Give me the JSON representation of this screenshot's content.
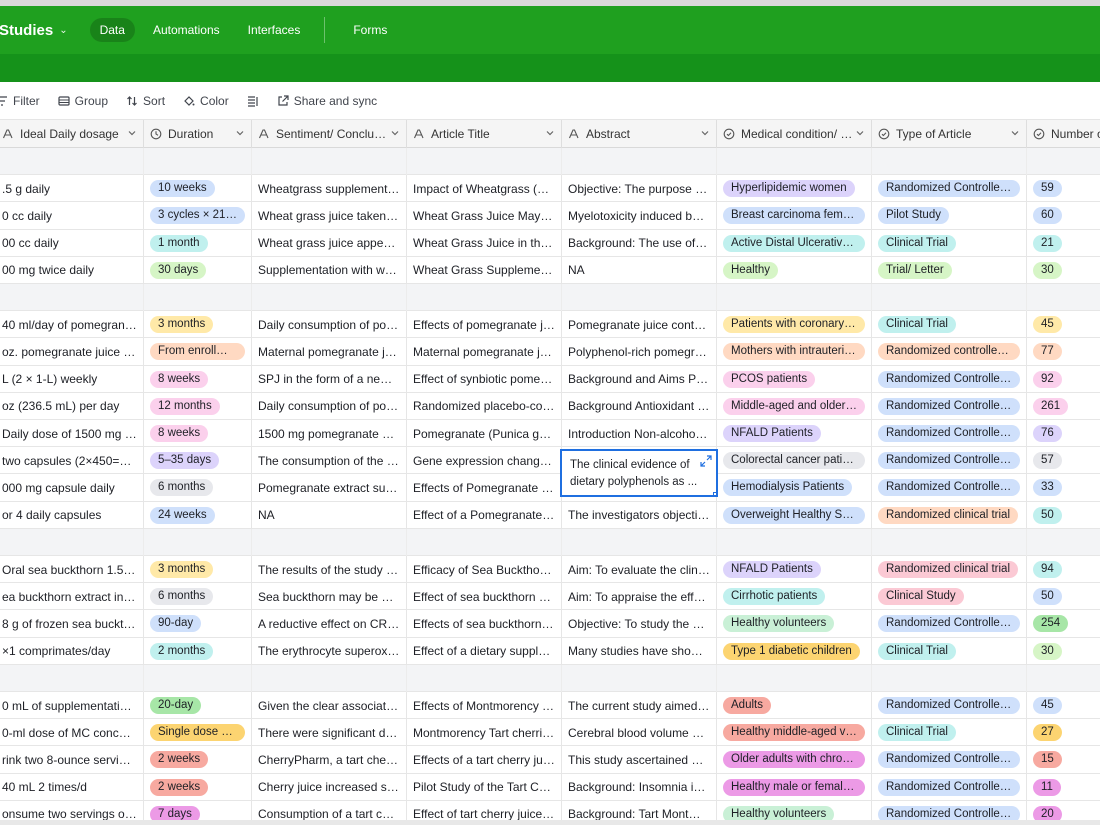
{
  "app": {
    "title": "Studies",
    "tabs": [
      {
        "label": "Data"
      },
      {
        "label": "Automations"
      },
      {
        "label": "Interfaces"
      },
      {
        "label": "Forms"
      }
    ]
  },
  "toolbar": {
    "filter": "Filter",
    "group": "Group",
    "sort": "Sort",
    "color": "Color",
    "share": "Share and sync"
  },
  "columns": [
    {
      "label": "Ideal Daily dosage"
    },
    {
      "label": "Duration"
    },
    {
      "label": "Sentiment/ Conclusion"
    },
    {
      "label": "Article Title"
    },
    {
      "label": "Abstract"
    },
    {
      "label": "Medical condition/ P..."
    },
    {
      "label": "Type of Article"
    },
    {
      "label": "Number of"
    }
  ],
  "colors": {
    "blue": "#cfe0fb",
    "green": "#c9f0d6",
    "yellow": "#ffe9a8",
    "orange": "#ffd9c2",
    "pink": "#fbd0ec",
    "purple": "#dcd3fb",
    "teal": "#c0f0ee",
    "grey": "#e7e8ec",
    "lime": "#d6f5c6",
    "darkgreen": "#a7e6a7",
    "gold": "#fcd471",
    "red": "#f7a9a0",
    "magenta": "#ec9ae6",
    "lightpink": "#fbc9d4"
  },
  "rows": [
    {
      "blank": true
    },
    {
      "dosage": ".5 g daily",
      "duration": {
        "text": "10 weeks",
        "color": "blue"
      },
      "sentiment": "Wheatgrass supplementati...",
      "title": "Impact of Wheatgrass (Triti...",
      "abstract": "Objective: The purpose of t...",
      "condition": {
        "text": "Hyperlipidemic women",
        "color": "purple"
      },
      "type": {
        "text": "Randomized Controlled ...",
        "color": "blue"
      },
      "number": {
        "text": "59",
        "color": "blue"
      }
    },
    {
      "dosage": "0 cc daily",
      "duration": {
        "text": "3 cycles × 21 d...",
        "color": "blue"
      },
      "sentiment": "Wheat grass juice taken du...",
      "title": "Wheat Grass Juice May Im...",
      "abstract": "Myelotoxicity induced by c...",
      "condition": {
        "text": "Breast carcinoma female...",
        "color": "blue"
      },
      "type": {
        "text": "Pilot Study",
        "color": "blue"
      },
      "number": {
        "text": "60",
        "color": "blue"
      }
    },
    {
      "dosage": "00 cc daily",
      "duration": {
        "text": "1 month",
        "color": "teal"
      },
      "sentiment": "Wheat grass juice appeare...",
      "title": "Wheat Grass Juice in the Tr...",
      "abstract": "Background: The use of wh...",
      "condition": {
        "text": "Active Distal Ulcerative ...",
        "color": "teal"
      },
      "type": {
        "text": "Clinical Trial",
        "color": "teal"
      },
      "number": {
        "text": "21",
        "color": "teal"
      }
    },
    {
      "dosage": "00 mg twice daily",
      "duration": {
        "text": "30 days",
        "color": "lime"
      },
      "sentiment": "Supplementation with whe...",
      "title": "Wheat Grass Supplementat...",
      "abstract": "NA",
      "condition": {
        "text": "Healthy",
        "color": "lime"
      },
      "type": {
        "text": "Trial/ Letter",
        "color": "lime"
      },
      "number": {
        "text": "30",
        "color": "lime"
      }
    },
    {
      "blank": true
    },
    {
      "dosage": "40 ml/day of pomegranat...",
      "duration": {
        "text": "3 months",
        "color": "yellow"
      },
      "sentiment": "Daily consumption of pom...",
      "title": "Effects of pomegranate juic...",
      "abstract": "Pomegranate juice contain...",
      "condition": {
        "text": "Patients with coronary h...",
        "color": "yellow"
      },
      "type": {
        "text": "Clinical Trial",
        "color": "teal"
      },
      "number": {
        "text": "45",
        "color": "yellow"
      }
    },
    {
      "dosage": "oz. pomegranate juice da...",
      "duration": {
        "text": "From enrollme...",
        "color": "orange"
      },
      "sentiment": "Maternal pomegranate juic...",
      "title": "Maternal pomegranate juic...",
      "abstract": "Polyphenol-rich pomegran...",
      "condition": {
        "text": "Mothers with intrauterin...",
        "color": "orange"
      },
      "type": {
        "text": "Randomized controlled ...",
        "color": "orange"
      },
      "number": {
        "text": "77",
        "color": "orange"
      }
    },
    {
      "dosage": "L (2 × 1-L) weekly",
      "duration": {
        "text": "8 weeks",
        "color": "pink"
      },
      "sentiment": "SPJ in the form of a new be...",
      "title": "Effect of synbiotic pomegr...",
      "abstract": "Background and Aims Poly...",
      "condition": {
        "text": "PCOS patients",
        "color": "pink"
      },
      "type": {
        "text": "Randomized Controlled ...",
        "color": "blue"
      },
      "number": {
        "text": "92",
        "color": "pink"
      }
    },
    {
      "dosage": "oz (236.5 mL) per day",
      "duration": {
        "text": "12 months",
        "color": "pink"
      },
      "sentiment": "Daily consumption of pom...",
      "title": "Randomized placebo-contr...",
      "abstract": "Background Antioxidant nu...",
      "condition": {
        "text": "Middle-aged and older ...",
        "color": "pink"
      },
      "type": {
        "text": "Randomized Controlled ...",
        "color": "blue"
      },
      "number": {
        "text": "261",
        "color": "pink"
      }
    },
    {
      "dosage": "Daily dose of 1500 mg po...",
      "duration": {
        "text": "8 weeks",
        "color": "pink"
      },
      "sentiment": "1500 mg pomegranate pee...",
      "title": "Pomegranate (Punica gran...",
      "abstract": "Introduction Non-alcoholic...",
      "condition": {
        "text": "NFALD Patients",
        "color": "purple"
      },
      "type": {
        "text": "Randomized Controlled ...",
        "color": "blue"
      },
      "number": {
        "text": "76",
        "color": "purple"
      }
    },
    {
      "dosage": "two capsules (2×450=900 ...",
      "duration": {
        "text": "5–35 days",
        "color": "purple"
      },
      "sentiment": "The consumption of the Po...",
      "title": "Gene expression changes i...",
      "abstract": "",
      "condition": {
        "text": "Colorectal cancer patients",
        "color": "grey"
      },
      "type": {
        "text": "Randomized Controlled ...",
        "color": "blue"
      },
      "number": {
        "text": "57",
        "color": "grey"
      }
    },
    {
      "dosage": "000 mg capsule daily",
      "duration": {
        "text": "6 months",
        "color": "grey"
      },
      "sentiment": "Pomegranate extract suppl...",
      "title": "Effects of Pomegranate Ext...",
      "abstract": "",
      "condition": {
        "text": "Hemodialysis Patients",
        "color": "blue"
      },
      "type": {
        "text": "Randomized Controlled ...",
        "color": "blue"
      },
      "number": {
        "text": "33",
        "color": "blue"
      }
    },
    {
      "dosage": "or 4 daily capsules",
      "duration": {
        "text": "24 weeks",
        "color": "blue"
      },
      "sentiment": "NA",
      "title": "Effect of a Pomegranate Ex...",
      "abstract": "The investigators objective ...",
      "condition": {
        "text": "Overweight Healthy Sub...",
        "color": "blue"
      },
      "type": {
        "text": "Randomized clinical trial",
        "color": "orange"
      },
      "number": {
        "text": "50",
        "color": "teal"
      }
    },
    {
      "blank": true
    },
    {
      "dosage": "Oral sea buckthorn 1.5 g (3...",
      "duration": {
        "text": "3 months",
        "color": "yellow"
      },
      "sentiment": "The results of the study de...",
      "title": "Efficacy of Sea Buckthorn T...",
      "abstract": "Aim: To evaluate the clinica...",
      "condition": {
        "text": "NFALD Patients",
        "color": "purple"
      },
      "type": {
        "text": "Randomized clinical trial",
        "color": "lightpink"
      },
      "number": {
        "text": "94",
        "color": "teal"
      }
    },
    {
      "dosage": "ea buckthorn extract in fin...",
      "duration": {
        "text": "6 months",
        "color": "grey"
      },
      "sentiment": "Sea buckthorn may be a ho...",
      "title": "Effect of sea buckthorn on ...",
      "abstract": "Aim: To appraise the effect ...",
      "condition": {
        "text": "Cirrhotic patients",
        "color": "teal"
      },
      "type": {
        "text": "Clinical Study",
        "color": "lightpink"
      },
      "number": {
        "text": "50",
        "color": "blue"
      }
    },
    {
      "dosage": "8 g of frozen sea buckthor...",
      "duration": {
        "text": "90-day",
        "color": "blue"
      },
      "sentiment": "A reductive effect on CRP, ...",
      "title": "Effects of sea buckthorn be...",
      "abstract": "Objective: To study the effe...",
      "condition": {
        "text": "Healthy volunteers",
        "color": "green"
      },
      "type": {
        "text": "Randomized Controlled ...",
        "color": "blue"
      },
      "number": {
        "text": "254",
        "color": "darkgreen"
      }
    },
    {
      "dosage": "×1 comprimates/day",
      "duration": {
        "text": "2 months",
        "color": "teal"
      },
      "sentiment": "The erythrocyte superoxide...",
      "title": "Effect of a dietary supplem...",
      "abstract": "Many studies have shown t...",
      "condition": {
        "text": "Type 1 diabetic children",
        "color": "gold"
      },
      "type": {
        "text": "Clinical Trial",
        "color": "teal"
      },
      "number": {
        "text": "30",
        "color": "lime"
      }
    },
    {
      "blank": true
    },
    {
      "dosage": "0 mL of supplementation ...",
      "duration": {
        "text": "20-day",
        "color": "darkgreen"
      },
      "sentiment": "Given the clear association ...",
      "title": "Effects of Montmorency Ta...",
      "abstract": "The current study aimed to...",
      "condition": {
        "text": "Adults",
        "color": "red"
      },
      "type": {
        "text": "Randomized Controlled ...",
        "color": "blue"
      },
      "number": {
        "text": "45",
        "color": "blue"
      }
    },
    {
      "dosage": "0-ml dose of MC concentr...",
      "duration": {
        "text": "Single dose wit...",
        "color": "gold"
      },
      "sentiment": "There were significant diffe...",
      "title": "Montmorency Tart cherries ...",
      "abstract": "Cerebral blood volume and...",
      "condition": {
        "text": "Healthy middle-aged vo...",
        "color": "red"
      },
      "type": {
        "text": "Clinical Trial",
        "color": "teal"
      },
      "number": {
        "text": "27",
        "color": "gold"
      }
    },
    {
      "dosage": "rink two 8-ounce servings",
      "duration": {
        "text": "2 weeks",
        "color": "red"
      },
      "sentiment": "CherryPharm, a tart cherry j...",
      "title": "Effects of a tart cherry juice...",
      "abstract": "This study ascertained whe...",
      "condition": {
        "text": "Older adults with chroni...",
        "color": "magenta"
      },
      "type": {
        "text": "Randomized Controlled ...",
        "color": "blue"
      },
      "number": {
        "text": "15",
        "color": "red"
      }
    },
    {
      "dosage": "40 mL 2 times/d",
      "duration": {
        "text": "2 weeks",
        "color": "red"
      },
      "sentiment": "Cherry juice increased slee...",
      "title": "Pilot Study of the Tart Cher...",
      "abstract": "Background: Insomnia is co...",
      "condition": {
        "text": "Healthy male or female ...",
        "color": "magenta"
      },
      "type": {
        "text": "Randomized Controlled ...",
        "color": "blue"
      },
      "number": {
        "text": "11",
        "color": "magenta"
      }
    },
    {
      "dosage": "onsume two servings of 2...",
      "duration": {
        "text": "7 days",
        "color": "magenta"
      },
      "sentiment": "Consumption of a tart cher...",
      "title": "Effect of tart cherry juice (P...",
      "abstract": "Background: Tart Montmor...",
      "condition": {
        "text": "Healthy volunteers",
        "color": "green"
      },
      "type": {
        "text": "Randomized Controlled ...",
        "color": "blue"
      },
      "number": {
        "text": "20",
        "color": "magenta"
      }
    }
  ],
  "expanded_abstract": "The clinical evidence of dietary polyphenols as ..."
}
